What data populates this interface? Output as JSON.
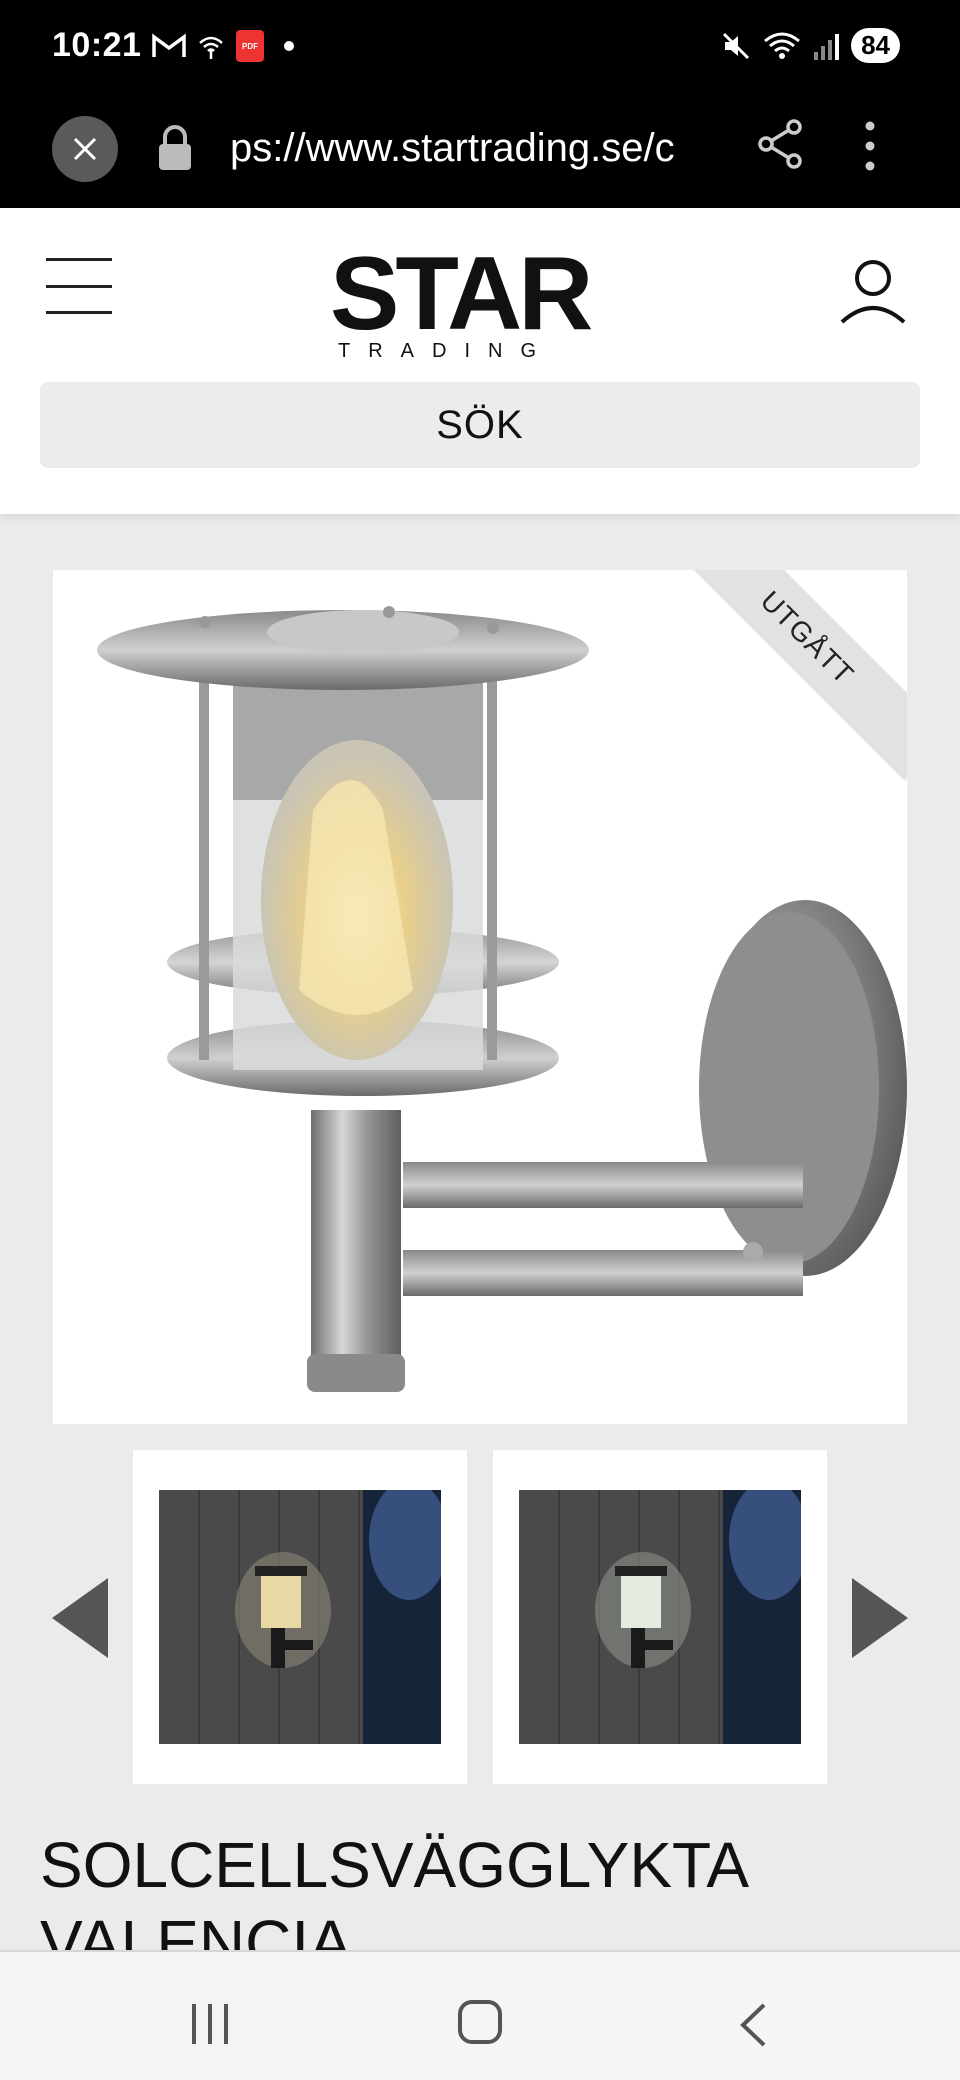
{
  "status_bar": {
    "time": "10:21",
    "pdf_label": "PDF",
    "battery": "84"
  },
  "browser": {
    "url": "ps://www.startrading.se/c"
  },
  "header": {
    "logo_main": "STAR",
    "logo_sub": "TRADING",
    "search_label": "SÖK"
  },
  "product": {
    "badge": "UTGÅTT",
    "title": "SOLCELLSVÄGGLYKTA VALENCIA"
  },
  "colors": {
    "status_bg": "#000000",
    "page_bg": "#ebebeb",
    "ribbon": "#e2e2e2"
  }
}
